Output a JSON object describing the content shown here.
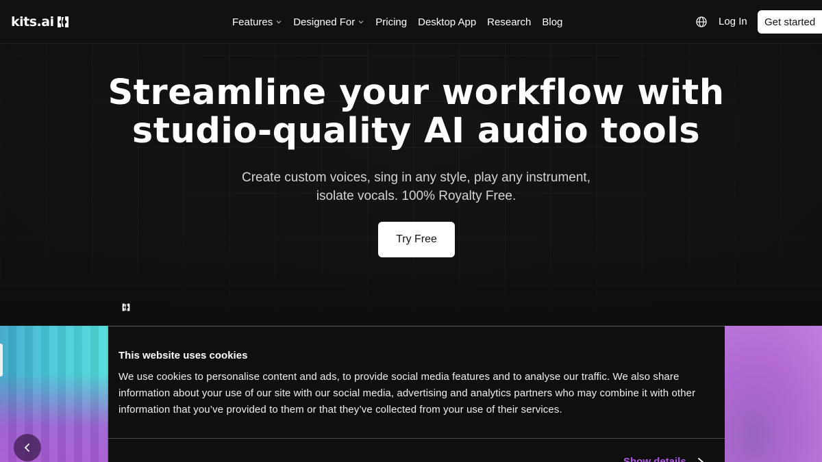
{
  "nav": {
    "logo_text": "kits.ai",
    "links": [
      {
        "label": "Features",
        "has_dropdown": true
      },
      {
        "label": "Designed For",
        "has_dropdown": true
      },
      {
        "label": "Pricing",
        "has_dropdown": false
      },
      {
        "label": "Desktop App",
        "has_dropdown": false
      },
      {
        "label": "Research",
        "has_dropdown": false
      },
      {
        "label": "Blog",
        "has_dropdown": false
      }
    ],
    "language_icon": "globe-icon",
    "login_label": "Log In",
    "cta_label": "Get started"
  },
  "hero": {
    "headline_line1": "Streamline your workflow with",
    "headline_line2": "studio-quality AI audio tools",
    "subline_line1": "Create custom voices, sing in any style, play any instrument,",
    "subline_line2": "isolate vocals. 100% Royalty Free.",
    "cta_label": "Try Free"
  },
  "carousel": {
    "prev_icon": "chevron-left-icon"
  },
  "cookie_banner": {
    "title": "This website uses cookies",
    "body": "We use cookies to personalise content and ads, to provide social media features and to analyse our traffic. We also share information about your use of our site with our social media, advertising and analytics partners who may combine it with other information that you’ve provided to them or that they’ve collected from your use of their services.",
    "details_label": "Show details"
  },
  "colors": {
    "background": "#0e0e0f",
    "accent_purple": "#b357e8",
    "button_bg": "#ffffff"
  }
}
